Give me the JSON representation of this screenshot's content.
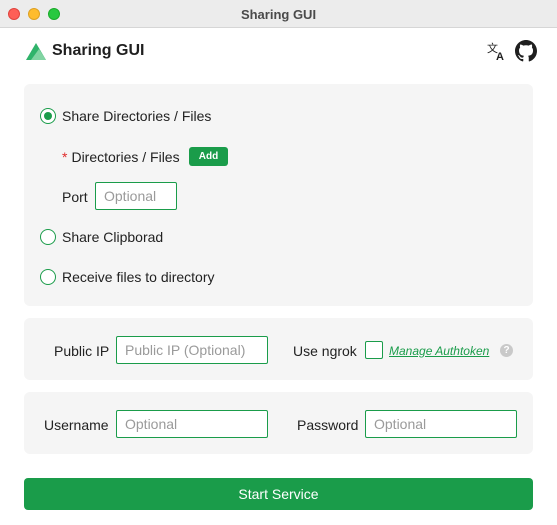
{
  "window": {
    "title": "Sharing GUI"
  },
  "header": {
    "app_title": "Sharing GUI"
  },
  "share_options": {
    "share_dirs_label": "Share Directories / Files",
    "share_dirs_selected": true,
    "dirs_files_label": "Directories / Files",
    "required_marker": "*",
    "add_button": "Add",
    "port_label": "Port",
    "port_placeholder": "Optional",
    "share_clipboard_label": "Share Clipborad",
    "receive_files_label": "Receive files to directory"
  },
  "network": {
    "public_ip_label": "Public IP",
    "public_ip_placeholder": "Public IP (Optional)",
    "use_ngrok_label": "Use ngrok",
    "use_ngrok_checked": false,
    "manage_authtoken_link": "Manage Authtoken",
    "help_glyph": "?"
  },
  "auth": {
    "username_label": "Username",
    "username_placeholder": "Optional",
    "password_label": "Password",
    "password_placeholder": "Optional"
  },
  "actions": {
    "start_service": "Start Service"
  },
  "colors": {
    "accent": "#1a9c4a",
    "required": "#e02b2b",
    "panel_bg": "#f5f5f5"
  },
  "icons": {
    "logo": "app-logo",
    "translate": "translate-icon",
    "github": "github-icon"
  }
}
